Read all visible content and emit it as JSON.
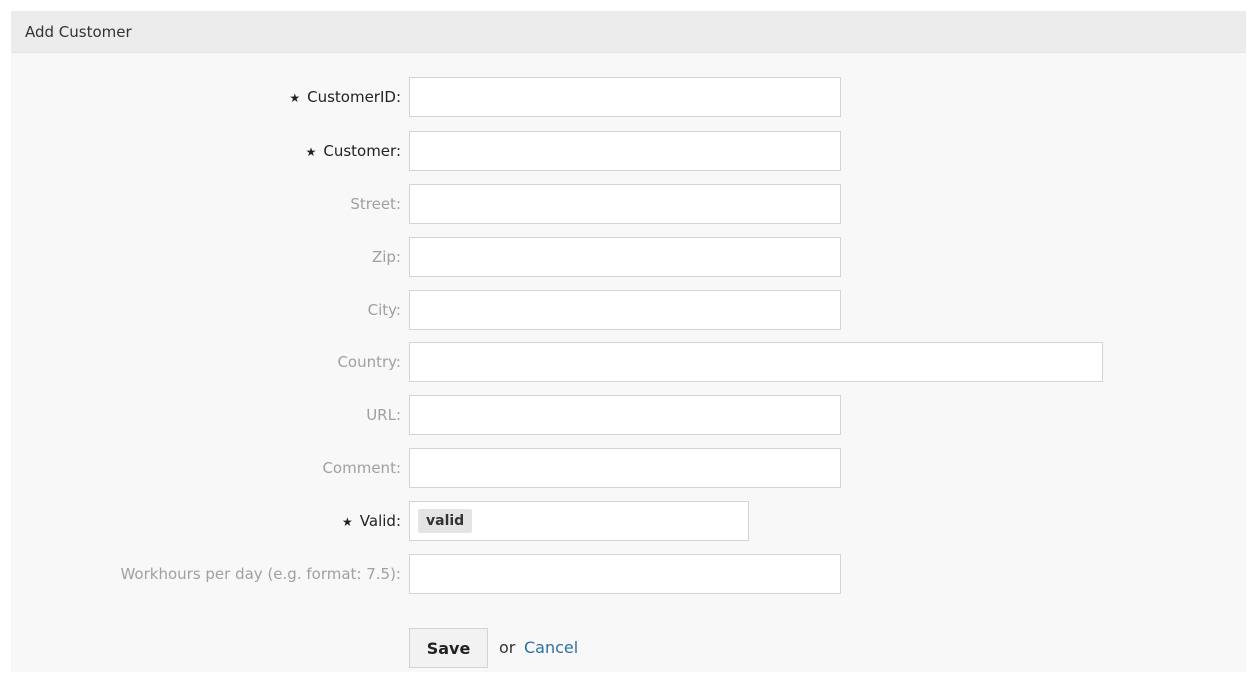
{
  "panel": {
    "title": "Add Customer"
  },
  "required_marker": "★",
  "fields": {
    "customer_id": {
      "label": "CustomerID:",
      "value": ""
    },
    "customer": {
      "label": "Customer:",
      "value": ""
    },
    "street": {
      "label": "Street:",
      "value": ""
    },
    "zip": {
      "label": "Zip:",
      "value": ""
    },
    "city": {
      "label": "City:",
      "value": ""
    },
    "country": {
      "label": "Country:",
      "value": ""
    },
    "url": {
      "label": "URL:",
      "value": ""
    },
    "comment": {
      "label": "Comment:",
      "value": ""
    },
    "valid": {
      "label": "Valid:",
      "selected": "valid"
    },
    "workhours": {
      "label": "Workhours per day (e.g. format: 7.5):",
      "value": ""
    }
  },
  "actions": {
    "save_label": "Save",
    "or_text": "or",
    "cancel_label": "Cancel"
  },
  "colors": {
    "link": "#2f6f9f",
    "panel_background": "#f8f8f8",
    "header_background": "#ececec"
  }
}
